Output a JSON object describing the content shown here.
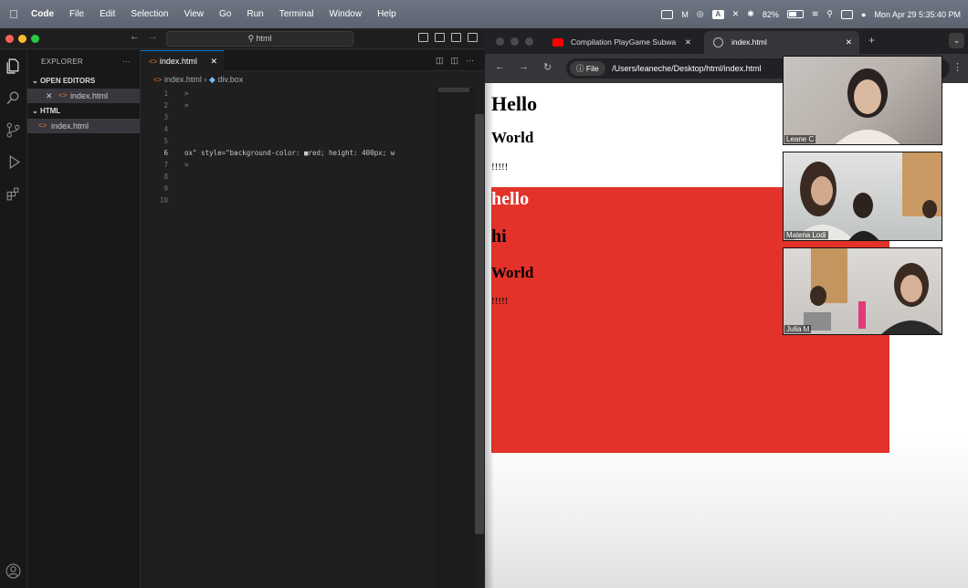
{
  "menubar": {
    "app": "Code",
    "items": [
      "File",
      "Edit",
      "Selection",
      "View",
      "Go",
      "Run",
      "Terminal",
      "Window",
      "Help"
    ],
    "battery": "82%",
    "datetime": "Mon Apr 29  5:35:40 PM"
  },
  "vscode": {
    "command_center": "html",
    "explorer_title": "EXPLORER",
    "open_editors_label": "OPEN EDITORS",
    "open_editor_file": "index.html",
    "folder_label": "HTML",
    "folder_file": "index.html",
    "tab_label": "index.html",
    "breadcrumb_file": "index.html",
    "breadcrumb_symbol": "div.box",
    "lines": [
      {
        "num": "1",
        "text": ">"
      },
      {
        "num": "2",
        "text": ">"
      },
      {
        "num": "3",
        "text": ""
      },
      {
        "num": "4",
        "text": ""
      },
      {
        "num": "5",
        "text": ""
      },
      {
        "num": "6",
        "text": "ox\" style=\"background-color: ■red; height: 400px; w"
      },
      {
        "num": "7",
        "text": ">"
      },
      {
        "num": "8",
        "text": ""
      },
      {
        "num": "9",
        "text": ""
      },
      {
        "num": "10",
        "text": ""
      }
    ]
  },
  "browser": {
    "tabs": [
      {
        "label": "Compilation PlayGame Subwa"
      },
      {
        "label": "index.html"
      }
    ],
    "address_chip": "File",
    "address": "/Users/leaneche/Desktop/html/index.html",
    "page": {
      "h1": "Hello",
      "h2": "World",
      "p": "!!!!!",
      "box_h1": "hello",
      "box_h1b": "hi",
      "box_h2": "World",
      "box_p": "!!!!!"
    }
  },
  "participants": [
    "Leane C",
    "Malena Lodi",
    "Julia M"
  ],
  "colors": {
    "red_box": "#e2322a",
    "accent": "#0078d4"
  }
}
